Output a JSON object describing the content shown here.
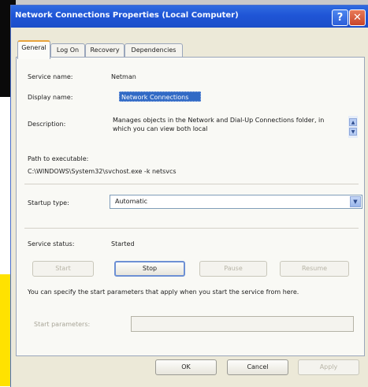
{
  "window": {
    "title": "Network Connections Properties (Local Computer)",
    "help_glyph": "?",
    "close_glyph": "✕"
  },
  "tabs": [
    {
      "label": "General"
    },
    {
      "label": "Log On"
    },
    {
      "label": "Recovery"
    },
    {
      "label": "Dependencies"
    }
  ],
  "general": {
    "service_name_label": "Service name:",
    "service_name_value": "Netman",
    "display_name_label": "Display name:",
    "display_name_value": "Network Connections",
    "description_label": "Description:",
    "description_value": "Manages objects in the Network and Dial-Up Connections folder, in which you can view both local",
    "path_label": "Path to executable:",
    "path_value": "C:\\WINDOWS\\System32\\svchost.exe -k netsvcs",
    "startup_label": "Startup type:",
    "startup_value": "Automatic",
    "status_label": "Service status:",
    "status_value": "Started",
    "start_button": "Start",
    "stop_button": "Stop",
    "pause_button": "Pause",
    "resume_button": "Resume",
    "note": "You can specify the start parameters that apply when you start the service from here.",
    "params_label": "Start parameters:",
    "params_value": ""
  },
  "footer": {
    "ok": "OK",
    "cancel": "Cancel",
    "apply": "Apply"
  },
  "colors": {
    "titlebar": "#1f55d6",
    "dialog_bg": "#ece9d8",
    "selection": "#316ac5",
    "close_button": "#c7452a",
    "background_yellow": "#ffe200",
    "background_black": "#0a0a0a"
  }
}
